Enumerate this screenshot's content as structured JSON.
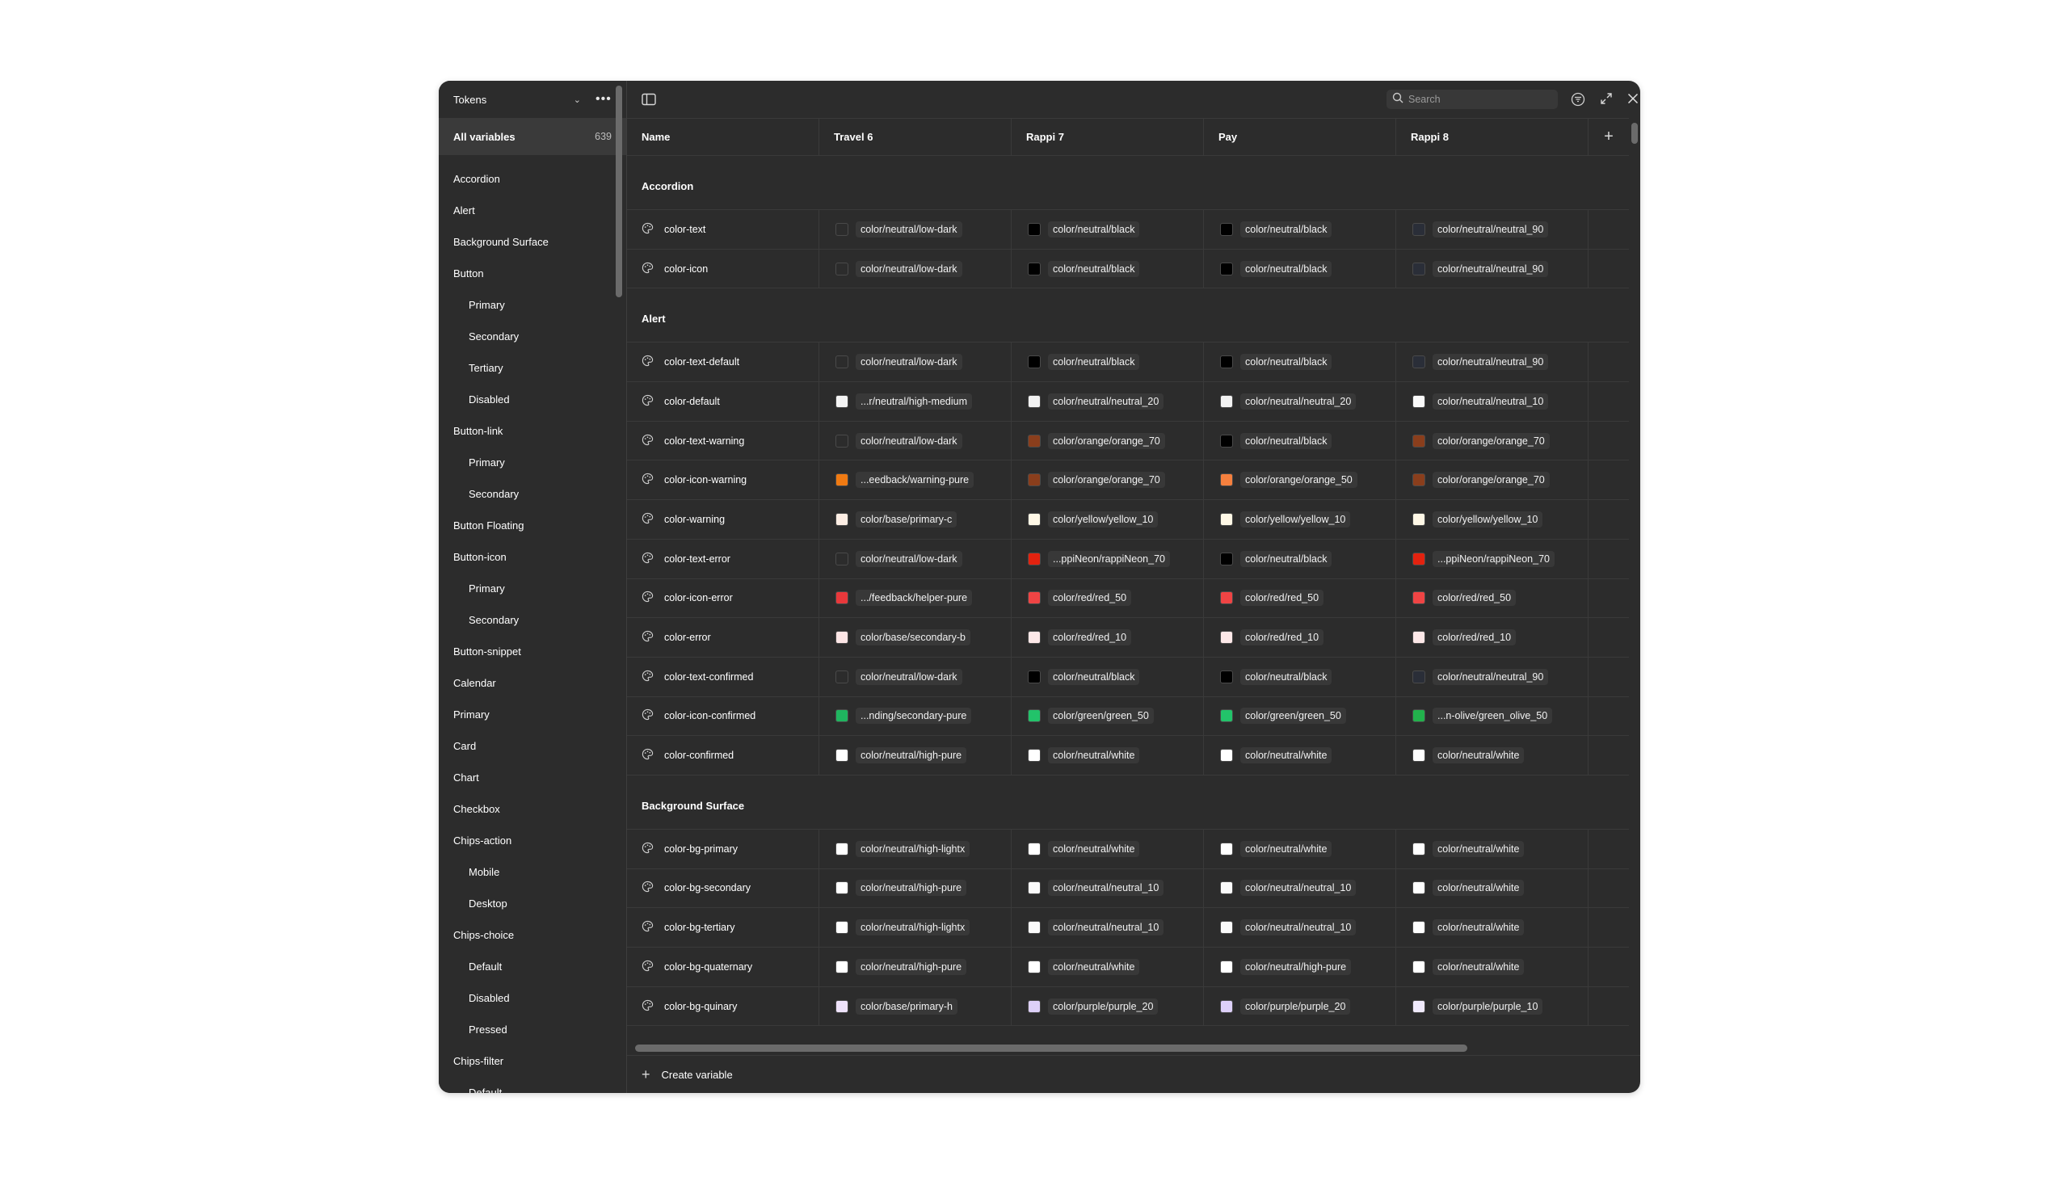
{
  "sidebar": {
    "collection": "Tokens",
    "all_label": "All variables",
    "all_count": "639",
    "groups": [
      {
        "label": "Accordion",
        "sub": false
      },
      {
        "label": "Alert",
        "sub": false
      },
      {
        "label": "Background Surface",
        "sub": false
      },
      {
        "label": "Button",
        "sub": false
      },
      {
        "label": "Primary",
        "sub": true
      },
      {
        "label": "Secondary",
        "sub": true
      },
      {
        "label": "Tertiary",
        "sub": true
      },
      {
        "label": "Disabled",
        "sub": true
      },
      {
        "label": "Button-link",
        "sub": false
      },
      {
        "label": "Primary",
        "sub": true
      },
      {
        "label": "Secondary",
        "sub": true
      },
      {
        "label": "Button Floating",
        "sub": false
      },
      {
        "label": "Button-icon",
        "sub": false
      },
      {
        "label": "Primary",
        "sub": true
      },
      {
        "label": "Secondary",
        "sub": true
      },
      {
        "label": "Button-snippet",
        "sub": false
      },
      {
        "label": "Calendar",
        "sub": false
      },
      {
        "label": "Primary",
        "sub": false
      },
      {
        "label": "Card",
        "sub": false
      },
      {
        "label": "Chart",
        "sub": false
      },
      {
        "label": "Checkbox",
        "sub": false
      },
      {
        "label": "Chips-action",
        "sub": false
      },
      {
        "label": "Mobile",
        "sub": true
      },
      {
        "label": "Desktop",
        "sub": true
      },
      {
        "label": "Chips-choice",
        "sub": false
      },
      {
        "label": "Default",
        "sub": true
      },
      {
        "label": "Disabled",
        "sub": true
      },
      {
        "label": "Pressed",
        "sub": true
      },
      {
        "label": "Chips-filter",
        "sub": false
      },
      {
        "label": "Default",
        "sub": true
      }
    ]
  },
  "toolbar": {
    "search_placeholder": "Search"
  },
  "columns": [
    "Name",
    "Travel 6",
    "Rappi 7",
    "Pay",
    "Rappi 8"
  ],
  "sections": [
    {
      "title": "Accordion",
      "rows": [
        {
          "name": "color-text",
          "values": [
            {
              "c": "#2c2c2c",
              "t": "color/neutral/low-dark"
            },
            {
              "c": "#000000",
              "t": "color/neutral/black"
            },
            {
              "c": "#000000",
              "t": "color/neutral/black"
            },
            {
              "c": "#2a2e38",
              "t": "color/neutral/neutral_90"
            }
          ]
        },
        {
          "name": "color-icon",
          "values": [
            {
              "c": "#2c2c2c",
              "t": "color/neutral/low-dark"
            },
            {
              "c": "#000000",
              "t": "color/neutral/black"
            },
            {
              "c": "#000000",
              "t": "color/neutral/black"
            },
            {
              "c": "#2a2e38",
              "t": "color/neutral/neutral_90"
            }
          ]
        }
      ]
    },
    {
      "title": "Alert",
      "rows": [
        {
          "name": "color-text-default",
          "values": [
            {
              "c": "#2c2c2c",
              "t": "color/neutral/low-dark"
            },
            {
              "c": "#000000",
              "t": "color/neutral/black"
            },
            {
              "c": "#000000",
              "t": "color/neutral/black"
            },
            {
              "c": "#2a2e38",
              "t": "color/neutral/neutral_90"
            }
          ]
        },
        {
          "name": "color-default",
          "values": [
            {
              "c": "#f4f4f4",
              "t": "...r/neutral/high-medium"
            },
            {
              "c": "#f2f2f2",
              "t": "color/neutral/neutral_20"
            },
            {
              "c": "#f2f2f2",
              "t": "color/neutral/neutral_20"
            },
            {
              "c": "#fafafa",
              "t": "color/neutral/neutral_10"
            }
          ]
        },
        {
          "name": "color-text-warning",
          "values": [
            {
              "c": "#2c2c2c",
              "t": "color/neutral/low-dark"
            },
            {
              "c": "#8a3e1c",
              "t": "color/orange/orange_70"
            },
            {
              "c": "#000000",
              "t": "color/neutral/black"
            },
            {
              "c": "#8a3e1c",
              "t": "color/orange/orange_70"
            }
          ]
        },
        {
          "name": "color-icon-warning",
          "values": [
            {
              "c": "#f07a12",
              "t": "...eedback/warning-pure"
            },
            {
              "c": "#8a3e1c",
              "t": "color/orange/orange_70"
            },
            {
              "c": "#f5803e",
              "t": "color/orange/orange_50"
            },
            {
              "c": "#8a3e1c",
              "t": "color/orange/orange_70"
            }
          ]
        },
        {
          "name": "color-warning",
          "values": [
            {
              "c": "#fdeee4",
              "t": "color/base/primary-c"
            },
            {
              "c": "#fff8e6",
              "t": "color/yellow/yellow_10"
            },
            {
              "c": "#fff8e6",
              "t": "color/yellow/yellow_10"
            },
            {
              "c": "#fff8e6",
              "t": "color/yellow/yellow_10"
            }
          ]
        },
        {
          "name": "color-text-error",
          "values": [
            {
              "c": "#2c2c2c",
              "t": "color/neutral/low-dark"
            },
            {
              "c": "#e3220f",
              "t": "...ppiNeon/rappiNeon_70"
            },
            {
              "c": "#000000",
              "t": "color/neutral/black"
            },
            {
              "c": "#e3220f",
              "t": "...ppiNeon/rappiNeon_70"
            }
          ]
        },
        {
          "name": "color-icon-error",
          "values": [
            {
              "c": "#e8383b",
              "t": ".../feedback/helper-pure"
            },
            {
              "c": "#ef4444",
              "t": "color/red/red_50"
            },
            {
              "c": "#ef4444",
              "t": "color/red/red_50"
            },
            {
              "c": "#ef4444",
              "t": "color/red/red_50"
            }
          ]
        },
        {
          "name": "color-error",
          "values": [
            {
              "c": "#fde6e6",
              "t": "color/base/secondary-b"
            },
            {
              "c": "#fde8e8",
              "t": "color/red/red_10"
            },
            {
              "c": "#fde8e8",
              "t": "color/red/red_10"
            },
            {
              "c": "#fde8e8",
              "t": "color/red/red_10"
            }
          ]
        },
        {
          "name": "color-text-confirmed",
          "values": [
            {
              "c": "#2c2c2c",
              "t": "color/neutral/low-dark"
            },
            {
              "c": "#000000",
              "t": "color/neutral/black"
            },
            {
              "c": "#000000",
              "t": "color/neutral/black"
            },
            {
              "c": "#2a2e38",
              "t": "color/neutral/neutral_90"
            }
          ]
        },
        {
          "name": "color-icon-confirmed",
          "values": [
            {
              "c": "#1fb55f",
              "t": "...nding/secondary-pure"
            },
            {
              "c": "#22c36a",
              "t": "color/green/green_50"
            },
            {
              "c": "#22c36a",
              "t": "color/green/green_50"
            },
            {
              "c": "#22b24c",
              "t": "...n-olive/green_olive_50"
            }
          ]
        },
        {
          "name": "color-confirmed",
          "values": [
            {
              "c": "#ffffff",
              "t": "color/neutral/high-pure"
            },
            {
              "c": "#ffffff",
              "t": "color/neutral/white"
            },
            {
              "c": "#ffffff",
              "t": "color/neutral/white"
            },
            {
              "c": "#ffffff",
              "t": "color/neutral/white"
            }
          ]
        }
      ]
    },
    {
      "title": "Background Surface",
      "rows": [
        {
          "name": "color-bg-primary",
          "values": [
            {
              "c": "#ffffff",
              "t": "color/neutral/high-lightx"
            },
            {
              "c": "#ffffff",
              "t": "color/neutral/white"
            },
            {
              "c": "#ffffff",
              "t": "color/neutral/white"
            },
            {
              "c": "#ffffff",
              "t": "color/neutral/white"
            }
          ]
        },
        {
          "name": "color-bg-secondary",
          "values": [
            {
              "c": "#ffffff",
              "t": "color/neutral/high-pure"
            },
            {
              "c": "#fafafa",
              "t": "color/neutral/neutral_10"
            },
            {
              "c": "#fafafa",
              "t": "color/neutral/neutral_10"
            },
            {
              "c": "#ffffff",
              "t": "color/neutral/white"
            }
          ]
        },
        {
          "name": "color-bg-tertiary",
          "values": [
            {
              "c": "#ffffff",
              "t": "color/neutral/high-lightx"
            },
            {
              "c": "#fafafa",
              "t": "color/neutral/neutral_10"
            },
            {
              "c": "#fafafa",
              "t": "color/neutral/neutral_10"
            },
            {
              "c": "#ffffff",
              "t": "color/neutral/white"
            }
          ]
        },
        {
          "name": "color-bg-quaternary",
          "values": [
            {
              "c": "#ffffff",
              "t": "color/neutral/high-pure"
            },
            {
              "c": "#ffffff",
              "t": "color/neutral/white"
            },
            {
              "c": "#ffffff",
              "t": "color/neutral/high-pure"
            },
            {
              "c": "#ffffff",
              "t": "color/neutral/white"
            }
          ]
        },
        {
          "name": "color-bg-quinary",
          "values": [
            {
              "c": "#efe3fb",
              "t": "color/base/primary-h"
            },
            {
              "c": "#ddd0f8",
              "t": "color/purple/purple_20"
            },
            {
              "c": "#ddd0f8",
              "t": "color/purple/purple_20"
            },
            {
              "c": "#f0eafc",
              "t": "color/purple/purple_10"
            }
          ]
        }
      ]
    }
  ],
  "footer": {
    "create_label": "Create variable"
  }
}
